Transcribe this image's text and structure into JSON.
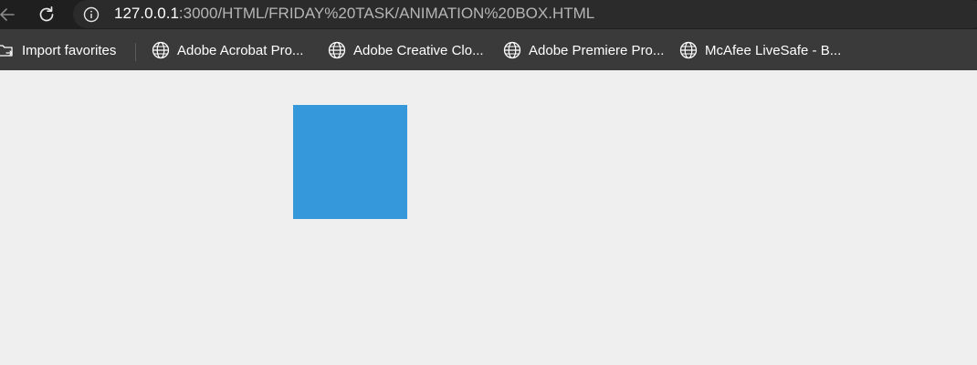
{
  "address_bar": {
    "url_host": "127.0.0.1",
    "url_path": ":3000/HTML/FRIDAY%20TASK/ANIMATION%20BOX.HTML"
  },
  "bookmarks": {
    "import_label": "Import favorites",
    "items": [
      {
        "label": "Adobe Acrobat Pro...",
        "icon": "globe-icon"
      },
      {
        "label": "Adobe Creative Clo...",
        "icon": "globe-icon"
      },
      {
        "label": "Adobe Premiere Pro...",
        "icon": "globe-icon"
      },
      {
        "label": "McAfee LiveSafe - B...",
        "icon": "globe-icon"
      }
    ]
  },
  "page": {
    "box_color": "#3498db",
    "background": "#efefef"
  }
}
